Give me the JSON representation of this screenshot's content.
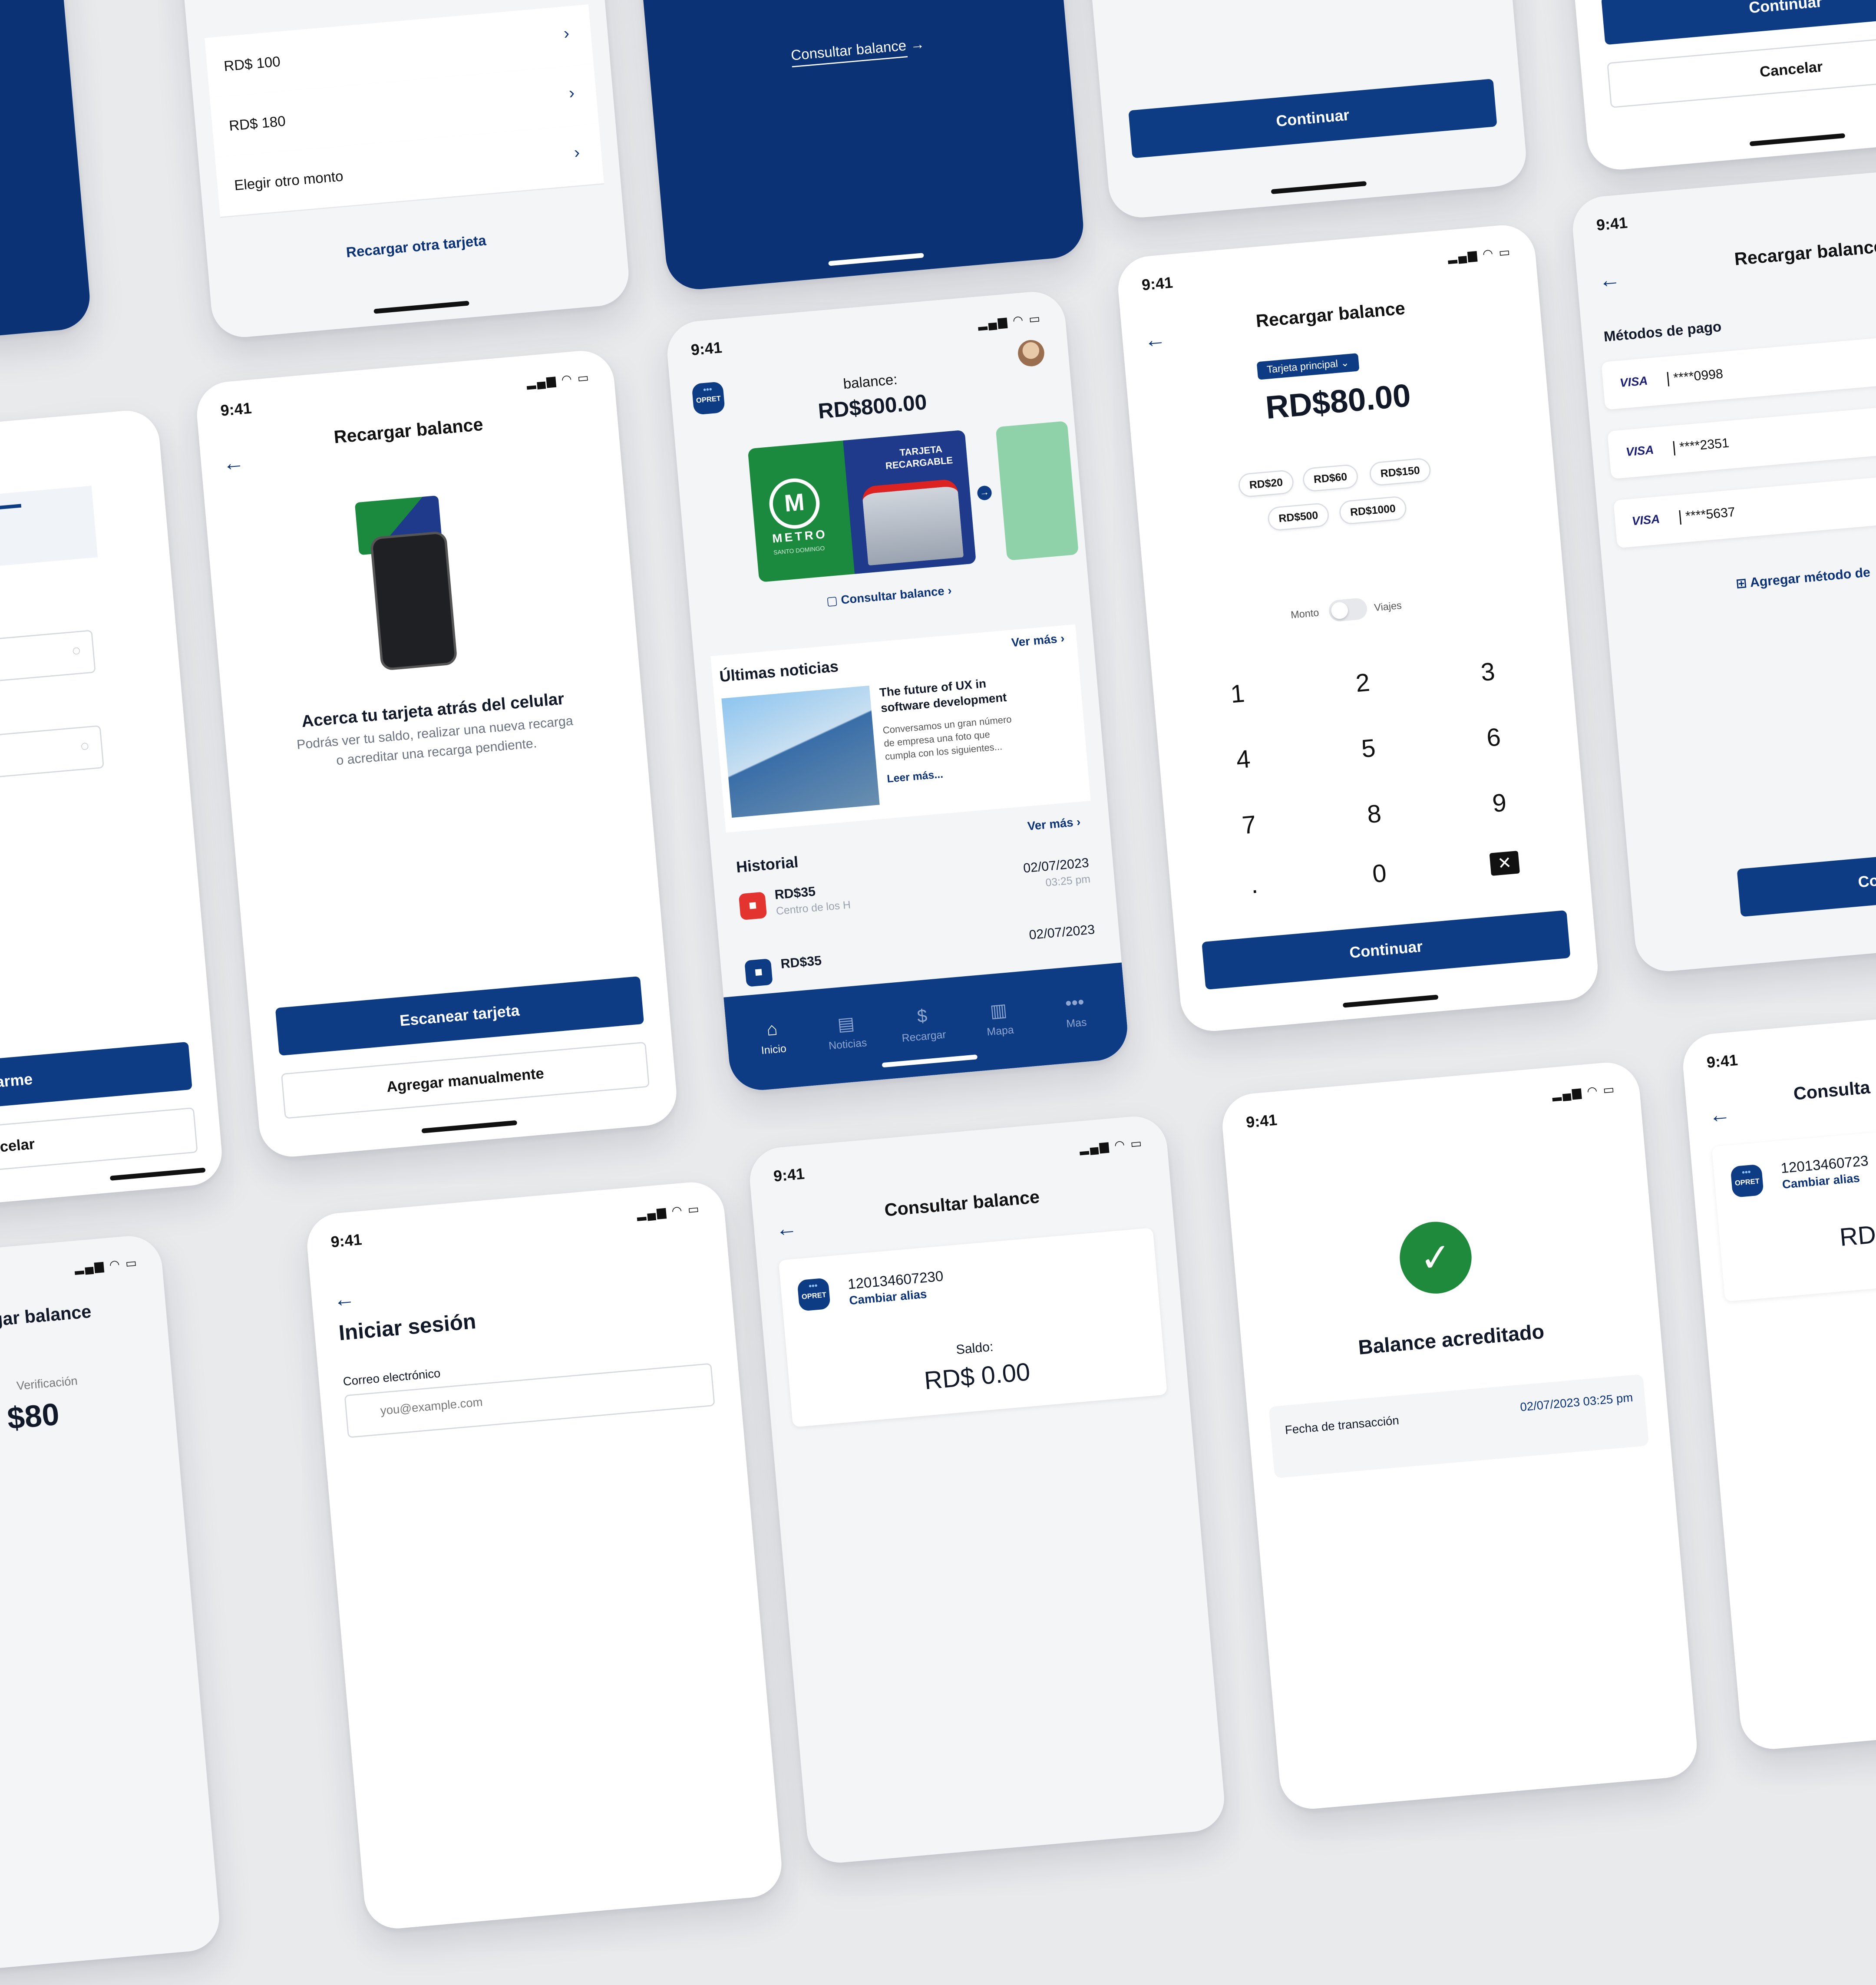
{
  "status": {
    "time": "9:41"
  },
  "common": {
    "continue": "Continuar",
    "cancel": "Cancelar"
  },
  "amounts_screen": {
    "rows": [
      "RD$ 100",
      "RD$ 180",
      "Elegir otro monto"
    ],
    "link": "Recargar otra tarjeta"
  },
  "consult_link": {
    "label": "Consultar balance"
  },
  "recharge_confirm": {
    "button": "Continuar"
  },
  "scan_screen": {
    "title": "Recargar balance",
    "heading": "Acerca tu tarjeta atrás del celular",
    "body_line1": "Podrás ver tu saldo, realizar una nueva recarga",
    "body_line2": "o acreditar una recarga pendiente.",
    "scan_button": "Escanear tarjeta",
    "manual_button": "Agregar manualmente"
  },
  "left_partial": {
    "primary": "strarme",
    "secondary": "ancelar"
  },
  "home": {
    "logo": "OPRET",
    "balance_label": "balance:",
    "balance_value": "RD$800.00",
    "card_label_line1": "TARJETA",
    "card_label_line2": "RECARGABLE",
    "card_brand": "METRO",
    "card_brand_sub": "SANTO DOMINGO",
    "consult_link": "Consultar balance",
    "news_title": "Últimas noticias",
    "see_more": "Ver más",
    "news_headline_1": "The future of UX in",
    "news_headline_2": "software development",
    "news_body_1": "Conversamos un gran número",
    "news_body_2": "de empresa una foto que",
    "news_body_3": "cumpla con  los siguientes...",
    "read_more": "Leer más...",
    "history_title": "Historial",
    "history": [
      {
        "amount": "RD$35",
        "place": "Centro de los H",
        "date": "02/07/2023",
        "time": "03:25 pm"
      },
      {
        "amount": "RD$35",
        "place": "",
        "date": "02/07/2023",
        "time": ""
      }
    ],
    "tabs": [
      "Inicio",
      "Noticias",
      "Recargar",
      "Mapa",
      "Mas"
    ]
  },
  "keypad_screen": {
    "title": "Recargar balance",
    "card_selector": "Tarjeta principal",
    "amount": "RD$80.00",
    "chips": [
      "RD$20",
      "RD$60",
      "RD$150",
      "RD$500",
      "RD$1000"
    ],
    "toggle_left": "Monto",
    "toggle_right": "Viajes",
    "keys": [
      "1",
      "2",
      "3",
      "4",
      "5",
      "6",
      "7",
      "8",
      "9",
      ".",
      "0"
    ],
    "button": "Continuar"
  },
  "payment_screen": {
    "title": "Recargar balance",
    "section": "Métodos de pago",
    "cards": [
      {
        "brand": "VISA",
        "number": "****0998"
      },
      {
        "brand": "VISA",
        "number": "****2351"
      },
      {
        "brand": "VISA",
        "number": "****5637"
      }
    ],
    "add_method": "Agregar método de",
    "button": "Continu"
  },
  "right_top_partial": {
    "primary": "Continuar",
    "cancel": "Cancelar"
  },
  "consult_screen": {
    "title": "Consultar balance",
    "logo": "OPRET",
    "card_number": "120134607230",
    "change_alias": "Cambiar alias",
    "saldo_label": "Saldo:",
    "saldo_value": "RD$ 0.00"
  },
  "success_screen": {
    "title": "Balance acreditado",
    "tx_label": "Fecha de transacción",
    "tx_value": "02/07/2023 03:25 pm"
  },
  "right_bottom_partial": {
    "title": "Consulta",
    "logo": "OPRET",
    "card_number": "12013460723",
    "change_alias": "Cambiar alias",
    "value": "RD"
  },
  "login_screen": {
    "title": "Iniciar sesión",
    "email_label": "Correo electrónico",
    "email_placeholder": "you@example.com"
  },
  "left_bottom_partial": {
    "title": "argar balance",
    "label": "Verificación",
    "value": "$80"
  },
  "colors": {
    "brand_navy": "#0b3275",
    "accent_blue": "#0d3c85",
    "success_green": "#1f8a3b",
    "metro_green": "#1c8a3e"
  }
}
